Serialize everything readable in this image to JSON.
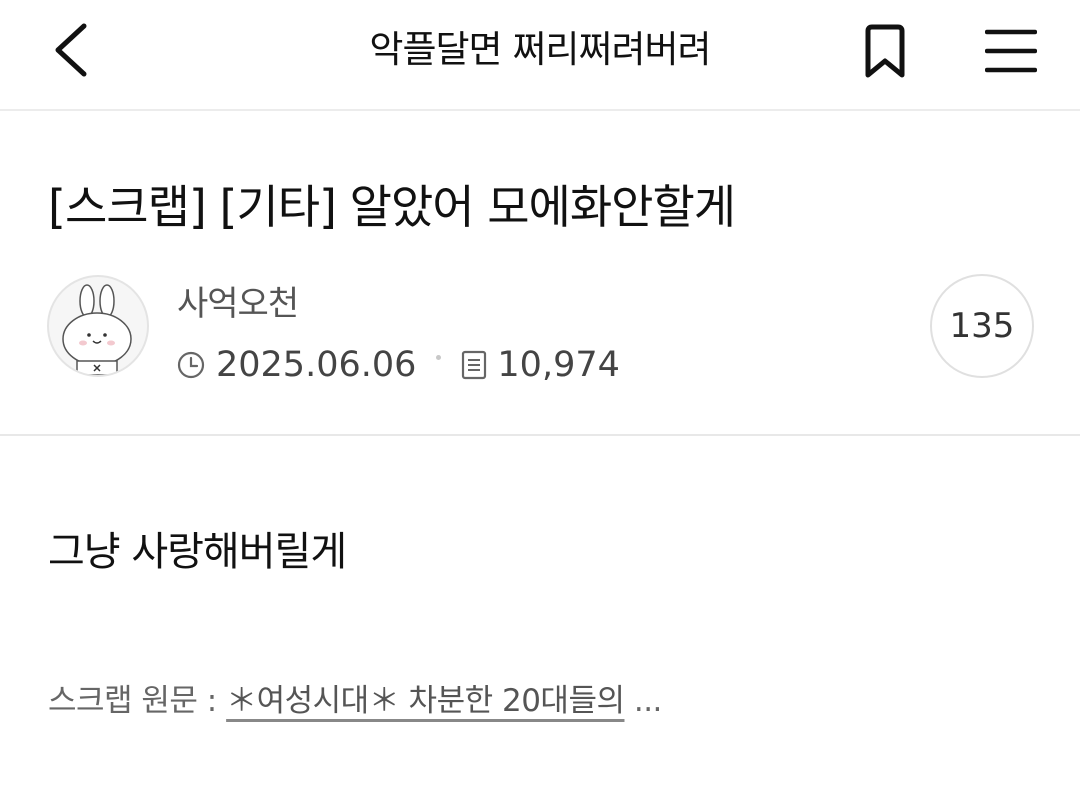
{
  "header": {
    "cafe_name": "악플달면 쩌리쩌려버려",
    "back_icon": "chevron-left-icon",
    "bookmark_icon": "bookmark-icon",
    "menu_icon": "hamburger-menu-icon"
  },
  "post": {
    "title": "[스크랩] [기타] 알았어 모에화안할게",
    "author": "사억오천",
    "date": "2025.06.06",
    "views": "10,974",
    "comment_count": "135",
    "body_text": "그냥 사랑해버릴게",
    "scrap_label": "스크랩 원문 :",
    "scrap_link": "＊여성시대＊ 차분한 20대들의",
    "scrap_ellipsis": "..."
  },
  "colors": {
    "text_primary": "#111111",
    "text_secondary": "#555555",
    "divider": "#e8e8e8"
  }
}
